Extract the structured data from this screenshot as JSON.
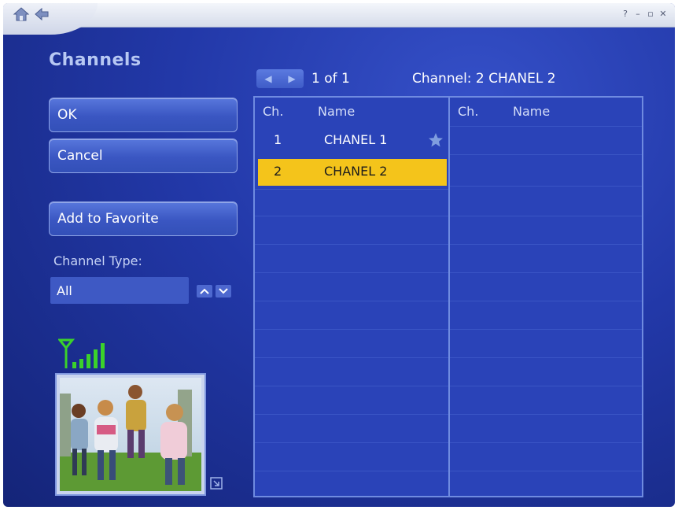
{
  "window": {
    "icons": [
      "home-icon",
      "back-arrow-icon"
    ],
    "controls": [
      "?",
      "–",
      "▫",
      "✕"
    ]
  },
  "page": {
    "title": "Channels"
  },
  "buttons": {
    "ok": "OK",
    "cancel": "Cancel",
    "add_favorite": "Add to Favorite"
  },
  "channel_type": {
    "label": "Channel Type:",
    "value": "All"
  },
  "pager": {
    "text": "1 of 1"
  },
  "status": {
    "channel": "Channel: 2 CHANEL 2"
  },
  "table": {
    "left_headers": {
      "ch": "Ch.",
      "name": "Name"
    },
    "right_headers": {
      "ch": "Ch.",
      "name": "Name"
    },
    "rows": [
      {
        "ch": "1",
        "name": "CHANEL 1",
        "favorite": true,
        "selected": false
      },
      {
        "ch": "2",
        "name": "CHANEL 2",
        "favorite": false,
        "selected": true
      }
    ]
  },
  "signal": {
    "icon": "signal-strength-icon",
    "bars": 5
  },
  "colors": {
    "selection": "#f4c41b",
    "signal": "#3bd22b",
    "background": "#2238a8"
  }
}
